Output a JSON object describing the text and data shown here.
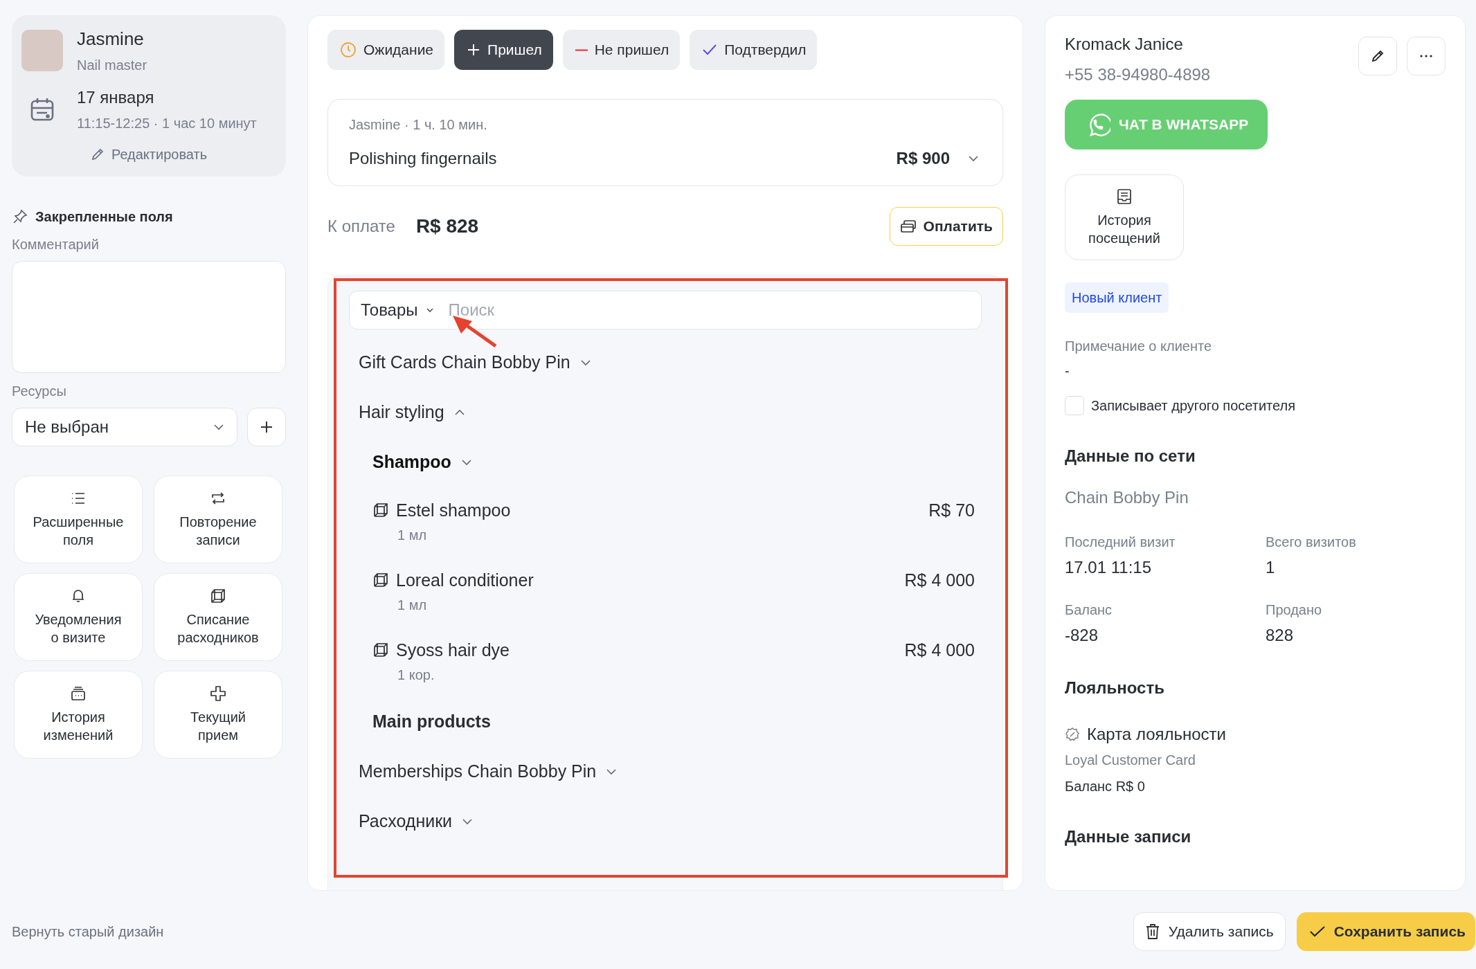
{
  "appointment": {
    "master_name": "Jasmine",
    "master_role": "Nail master",
    "date": "17 января",
    "time": "11:15-12:25 · 1 час 10 минут",
    "edit_label": "Редактировать"
  },
  "pinned": {
    "title": "Закрепленные поля",
    "comment_label": "Комментарий",
    "resources_label": "Ресурсы",
    "resource_value": "Не выбран"
  },
  "tiles": [
    {
      "label": "Расширенные\nполя"
    },
    {
      "label": "Повторение\nзаписи"
    },
    {
      "label": "Уведомления\nо визите"
    },
    {
      "label": "Списание\nрасходников"
    },
    {
      "label": "История\nизменений"
    },
    {
      "label": "Текущий\nприем"
    }
  ],
  "footer_link": "Вернуть старый дизайн",
  "statuses": [
    {
      "kind": "waiting",
      "label": "Ожидание",
      "selected": false
    },
    {
      "kind": "arrived",
      "label": "Пришел",
      "selected": true
    },
    {
      "kind": "noshow",
      "label": "Не пришел",
      "selected": false
    },
    {
      "kind": "confirmed",
      "label": "Подтвердил",
      "selected": false
    }
  ],
  "service": {
    "meta": "Jasmine · 1 ч. 10 мин.",
    "name": "Polishing fingernails",
    "price": "R$ 900"
  },
  "payment": {
    "label": "К оплате",
    "amount": "R$ 828",
    "button": "Оплатить"
  },
  "catalog": {
    "type": "Товары",
    "search_placeholder": "Поиск",
    "items": [
      {
        "kind": "category",
        "name": "Gift Cards Chain Bobby Pin",
        "expanded": false
      },
      {
        "kind": "category",
        "name": "Hair styling",
        "expanded": true,
        "children": [
          {
            "kind": "subcategory",
            "name": "Shampoo",
            "expanded": false
          },
          {
            "kind": "product",
            "name": "Estel shampoo",
            "unit": "1 мл",
            "price": "R$ 70"
          },
          {
            "kind": "product",
            "name": "Loreal conditioner",
            "unit": "1 мл",
            "price": "R$ 4 000"
          },
          {
            "kind": "product",
            "name": "Syoss hair dye",
            "unit": "1 кор.",
            "price": "R$ 4 000"
          },
          {
            "kind": "group",
            "name": "Main products"
          }
        ]
      },
      {
        "kind": "category",
        "name": "Memberships Chain Bobby Pin",
        "expanded": false
      },
      {
        "kind": "category",
        "name": "Расходники",
        "expanded": false
      }
    ]
  },
  "client": {
    "name": "Kromack Janice",
    "phone": "+55 38-94980-4898",
    "whatsapp": "ЧАТ В WHATSAPP",
    "history": "История\nпосещений",
    "tag": "Новый клиент",
    "note_label": "Примечание о клиенте",
    "note": "-",
    "other_visitor": {
      "label": "Записывает другого посетителя",
      "checked": false
    },
    "network_title": "Данные по сети",
    "network_name": "Chain Bobby Pin",
    "stats": [
      {
        "label": "Последний визит",
        "value": "17.01 11:15"
      },
      {
        "label": "Всего визитов",
        "value": "1"
      },
      {
        "label": "Баланс",
        "value": "-828"
      },
      {
        "label": "Продано",
        "value": "828"
      }
    ],
    "loyalty_title": "Лояльность",
    "loyalty_card": "Карта лояльности",
    "loyalty_name": "Loyal Customer Card",
    "loyalty_balance": "Баланс R$ 0",
    "record_title": "Данные записи"
  },
  "actions": {
    "delete": "Удалить запись",
    "save": "Сохранить запись"
  }
}
